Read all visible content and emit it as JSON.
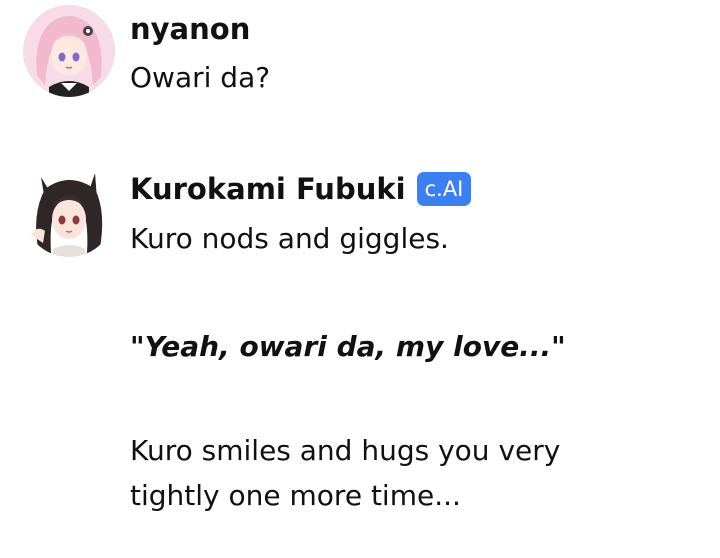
{
  "messages": [
    {
      "username": "nyanon",
      "avatar_icon": "pink-hair-anime-girl-avatar",
      "text": "Owari da?"
    },
    {
      "username": "Kurokami Fubuki",
      "badge": "c.AI",
      "avatar_icon": "black-hair-wolf-ear-anime-girl-avatar",
      "badge_color": "#3b7ff0",
      "paragraphs": [
        "Kuro nods and giggles.",
        "\"Yeah, owari da, my love...\"",
        "Kuro smiles and hugs you very tightly one more time..."
      ]
    }
  ]
}
